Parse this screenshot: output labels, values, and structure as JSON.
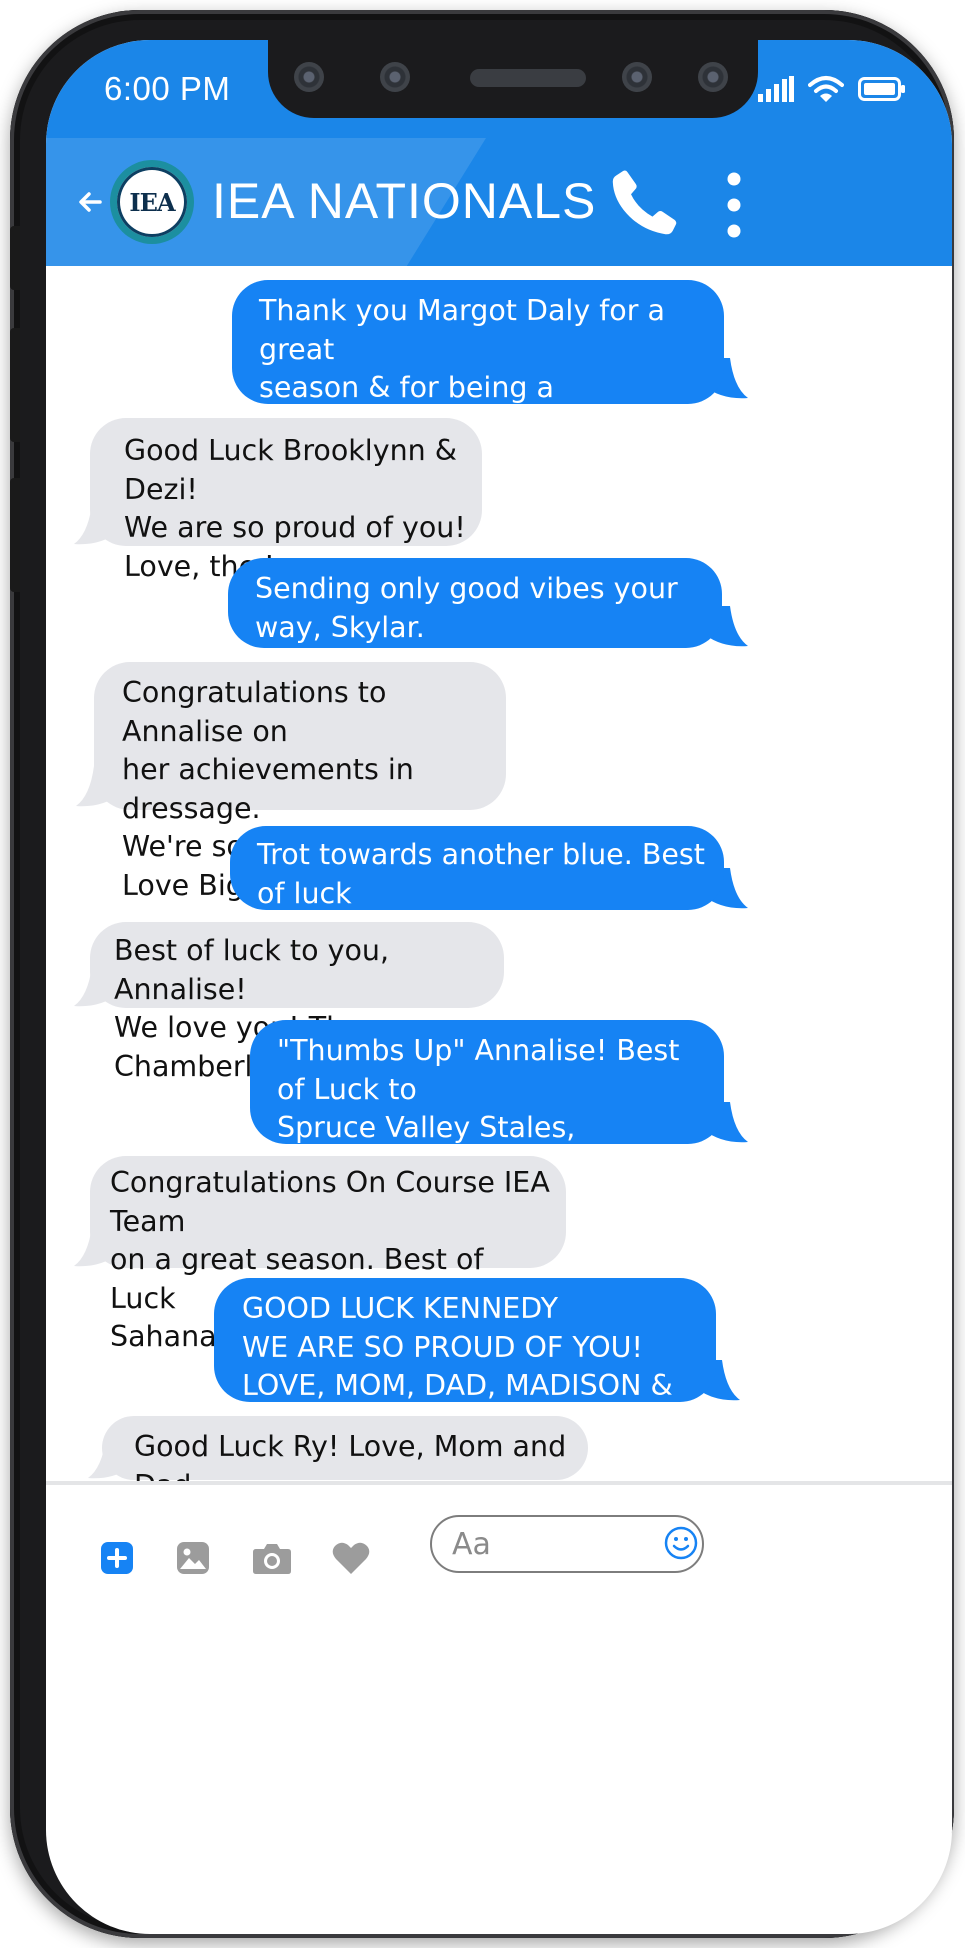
{
  "status_bar": {
    "time": "6:00 PM",
    "icons": [
      "signal-bars-icon",
      "wifi-icon",
      "battery-icon"
    ]
  },
  "header": {
    "back_icon": "back-arrow-icon",
    "logo_text": "IEA",
    "title": "IEA NATIONALS",
    "call_icon": "phone-icon",
    "menu_icon": "kebab-menu-icon"
  },
  "messages": [
    {
      "direction": "outgoing",
      "text": "Thank you Margot Daly for a great\nseason & for being a phenomenal coach!\nSincerely, Brooklynn"
    },
    {
      "direction": "incoming",
      "text": "Good Luck Brooklynn & Dezi!\nWe are so proud of you!\nLove, the Loparcos"
    },
    {
      "direction": "outgoing",
      "text": "Sending only good vibes your way, Skylar.\nLet's go! Love, Mom and Grands"
    },
    {
      "direction": "incoming",
      "text": "Congratulations to Annalise on\nher achievements in dressage.\nWe're so proud of you.\nLove Big Papa & Nana"
    },
    {
      "direction": "outgoing",
      "text": "Trot towards another blue. Best of luck\nAnnalise & SVS! Love Mimi & Little Papa"
    },
    {
      "direction": "incoming",
      "text": "Best of luck to you, Annalise!\nWe love you! The Chamberlains"
    },
    {
      "direction": "outgoing",
      "text": "\"Thumbs Up\" Annalise! Best of Luck to\nSpruce Valley Stales, Cazenovia NY.\nLove, Mom & Dad"
    },
    {
      "direction": "incoming",
      "text": "Congratulations On Course IEA Team\non a great season. Best of Luck\nSahana at Nationals!"
    },
    {
      "direction": "outgoing",
      "text": "GOOD LUCK KENNEDY\nWE ARE SO PROUD OF YOU!\nLOVE, MOM, DAD, MADISON & TAYLOR"
    },
    {
      "direction": "incoming",
      "text": "Good Luck Ry! Love, Mom and Dad"
    }
  ],
  "composer": {
    "tools": [
      "plus-icon",
      "gallery-icon",
      "camera-icon",
      "heart-icon"
    ],
    "placeholder": "Aa",
    "emoji_icon": "smiley-icon"
  },
  "colors": {
    "accent": "#1b86e8",
    "outgoing_bubble": "#1683f4",
    "incoming_bubble": "#e5e6ea"
  }
}
